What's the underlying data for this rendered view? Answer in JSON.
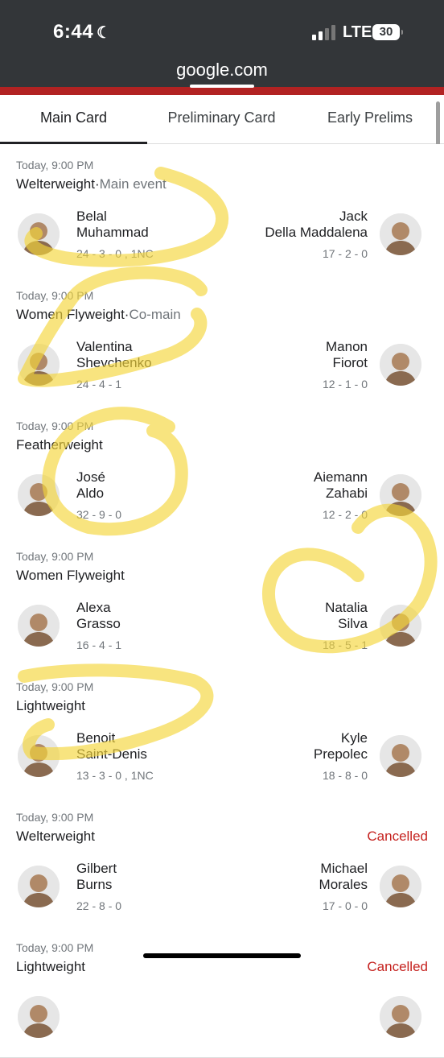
{
  "status_bar": {
    "time": "6:44",
    "network": "LTE",
    "battery": "30"
  },
  "browser": {
    "url": "google.com"
  },
  "tabs": [
    {
      "label": "Main Card",
      "active": true
    },
    {
      "label": "Preliminary Card",
      "active": false
    },
    {
      "label": "Early Prelims",
      "active": false
    }
  ],
  "fights": [
    {
      "date": "Today, 9:00 PM",
      "weight_class": "Welterweight",
      "tag": "Main event",
      "status": "",
      "left": {
        "first": "Belal",
        "last": "Muhammad",
        "record": "24 - 3 - 0 , 1NC"
      },
      "right": {
        "first": "Jack",
        "last": "Della Maddalena",
        "record": "17 - 2 - 0"
      }
    },
    {
      "date": "Today, 9:00 PM",
      "weight_class": "Women Flyweight",
      "tag": "Co-main",
      "status": "",
      "left": {
        "first": "Valentina",
        "last": "Shevchenko",
        "record": "24 - 4 - 1"
      },
      "right": {
        "first": "Manon",
        "last": "Fiorot",
        "record": "12 - 1 - 0"
      }
    },
    {
      "date": "Today, 9:00 PM",
      "weight_class": "Featherweight",
      "tag": "",
      "status": "",
      "left": {
        "first": "José",
        "last": "Aldo",
        "record": "32 - 9 - 0"
      },
      "right": {
        "first": "Aiemann",
        "last": "Zahabi",
        "record": "12 - 2 - 0"
      }
    },
    {
      "date": "Today, 9:00 PM",
      "weight_class": "Women Flyweight",
      "tag": "",
      "status": "",
      "left": {
        "first": "Alexa",
        "last": "Grasso",
        "record": "16 - 4 - 1"
      },
      "right": {
        "first": "Natalia",
        "last": "Silva",
        "record": "18 - 5 - 1"
      }
    },
    {
      "date": "Today, 9:00 PM",
      "weight_class": "Lightweight",
      "tag": "",
      "status": "",
      "left": {
        "first": "Benoit",
        "last": "Saint-Denis",
        "record": "13 - 3 - 0 , 1NC"
      },
      "right": {
        "first": "Kyle",
        "last": "Prepolec",
        "record": "18 - 8 - 0"
      }
    },
    {
      "date": "Today, 9:00 PM",
      "weight_class": "Welterweight",
      "tag": "",
      "status": "Cancelled",
      "left": {
        "first": "Gilbert",
        "last": "Burns",
        "record": "22 - 8 - 0"
      },
      "right": {
        "first": "Michael",
        "last": "Morales",
        "record": "17 - 0 - 0"
      }
    },
    {
      "date": "Today, 9:00 PM",
      "weight_class": "Lightweight",
      "tag": "",
      "status": "Cancelled",
      "left": {
        "first": "",
        "last": "",
        "record": ""
      },
      "right": {
        "first": "",
        "last": "",
        "record": ""
      }
    }
  ],
  "colors": {
    "status_bar": "#333639",
    "accent_red": "#b22222",
    "cancelled": "#c5221f",
    "highlighter": "#f5d63a"
  }
}
